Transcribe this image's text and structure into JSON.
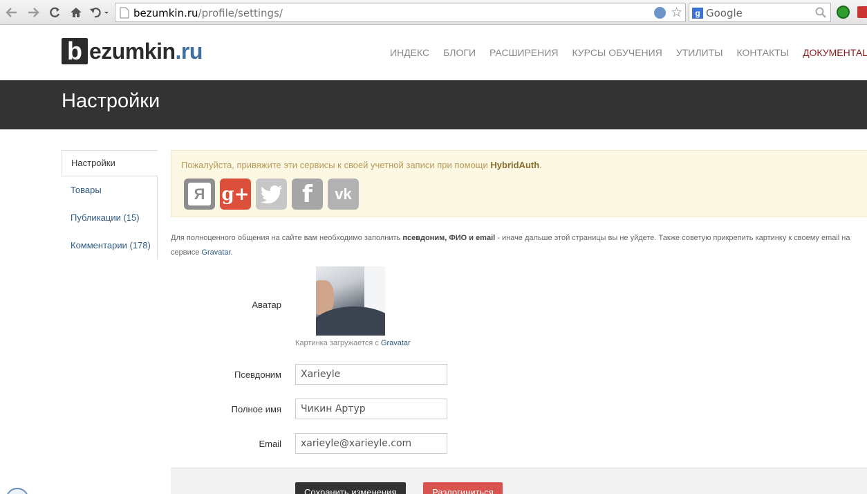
{
  "browser": {
    "url_host": "bezumkin.ru",
    "url_path": "/profile/settings/",
    "search_placeholder": "Google"
  },
  "site": {
    "logo_b": "b",
    "logo_word": "ezumkin",
    "logo_tld": ".ru",
    "nav": [
      "Индекс",
      "Блоги",
      "Расширения",
      "Курсы обучения",
      "Утилиты",
      "Контакты"
    ],
    "nav_doc": "ДОКУМЕНТАЦИЯ →"
  },
  "page": {
    "title": "Настройки"
  },
  "sidebar": {
    "items": [
      {
        "label": "Настройки"
      },
      {
        "label": "Товары"
      },
      {
        "label": "Публикации (15)"
      },
      {
        "label": "Комментарии (178)"
      }
    ]
  },
  "alert": {
    "text": "Пожалуйста, привяжите эти сервисы к своей учетной записи при помощи ",
    "brand": "HybridAuth",
    "suffix": ".",
    "services": {
      "yandex": "Я",
      "googleplus": "g+",
      "facebook": "f",
      "vk": "vk"
    }
  },
  "intro": {
    "part1": "Для полноценного общения на сайте вам необходимо заполнить ",
    "bold": "псевдоним, ФИО и email",
    "part2": " - иначе дальше этой страницы вы не уйдете. Также советую прикрепить картинку к своему email на сервисе ",
    "link": "Gravatar",
    "end": "."
  },
  "form": {
    "avatar_label": "Аватар",
    "avatar_note": "Картинка загружается с ",
    "avatar_link": "Gravatar",
    "nickname_label": "Псевдоним",
    "nickname_value": "Xarieyle",
    "fullname_label": "Полное имя",
    "fullname_value": "Чикин Артур",
    "email_label": "Email",
    "email_value": "xarieyle@xarieyle.com",
    "save_label": "Сохранить изменения",
    "logout_label": "Разлогиниться"
  }
}
